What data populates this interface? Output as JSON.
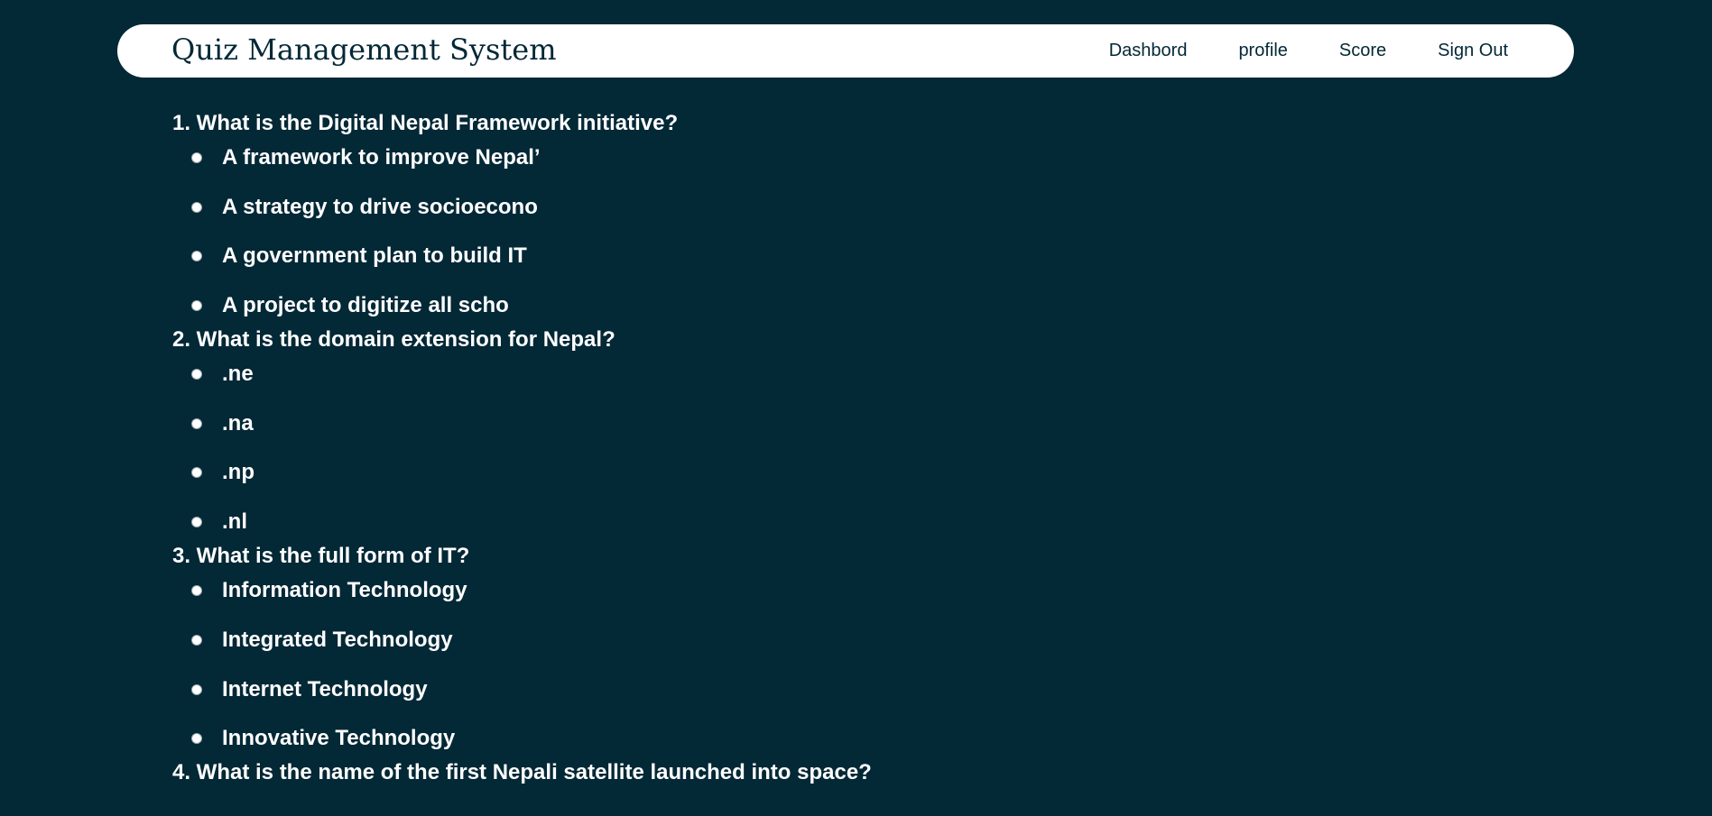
{
  "header": {
    "brand": "Quiz Management System",
    "nav": [
      "Dashbord",
      "profile",
      "Score",
      "Sign Out"
    ]
  },
  "questions": [
    {
      "text": "1. What is the Digital Nepal Framework initiative?",
      "options": [
        " A framework to improve Nepal’",
        "A strategy to drive socioecono",
        "A government plan to build IT",
        "A project to digitize all scho"
      ]
    },
    {
      "text": "2. What is the domain extension for Nepal?",
      "options": [
        ".ne",
        ".na",
        ".np",
        ".nl"
      ]
    },
    {
      "text": "3. What is the full form of IT?",
      "options": [
        "Information Technology",
        "Integrated Technology",
        "Internet Technology",
        "Innovative Technology"
      ]
    },
    {
      "text": "4. What is the name of the first Nepali satellite launched into space?",
      "options": []
    }
  ],
  "icons": {
    "option_marker": "radio-icon"
  },
  "colors": {
    "background": "#032836",
    "navbar": "#ffffff",
    "brand_text": "#032836",
    "question_text": "#ffffff"
  }
}
